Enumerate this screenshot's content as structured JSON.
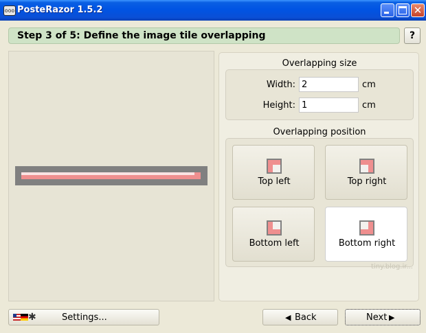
{
  "window": {
    "title": "PosteRazor 1.5.2",
    "app_icon_text": "ooo"
  },
  "header": {
    "step_title": "Step 3 of 5: Define the image tile overlapping",
    "help_label": "?"
  },
  "overlap_size": {
    "title": "Overlapping size",
    "width_label": "Width:",
    "width_value": "2",
    "width_unit": "cm",
    "height_label": "Height:",
    "height_value": "1",
    "height_unit": "cm"
  },
  "overlap_position": {
    "title": "Overlapping position",
    "options": [
      {
        "label": "Top left",
        "corner": "top-left",
        "selected": false
      },
      {
        "label": "Top right",
        "corner": "top-right",
        "selected": false
      },
      {
        "label": "Bottom left",
        "corner": "bottom-left",
        "selected": false
      },
      {
        "label": "Bottom right",
        "corner": "bottom-right",
        "selected": true
      }
    ]
  },
  "footer": {
    "settings_label": "Settings...",
    "back_label": "Back",
    "next_label": "Next"
  },
  "colors": {
    "accent_header": "#cfe3c6",
    "overlap_fill": "#ef8f8f",
    "frame_gray": "#808080"
  },
  "watermark": "tiny.blog.ir..."
}
